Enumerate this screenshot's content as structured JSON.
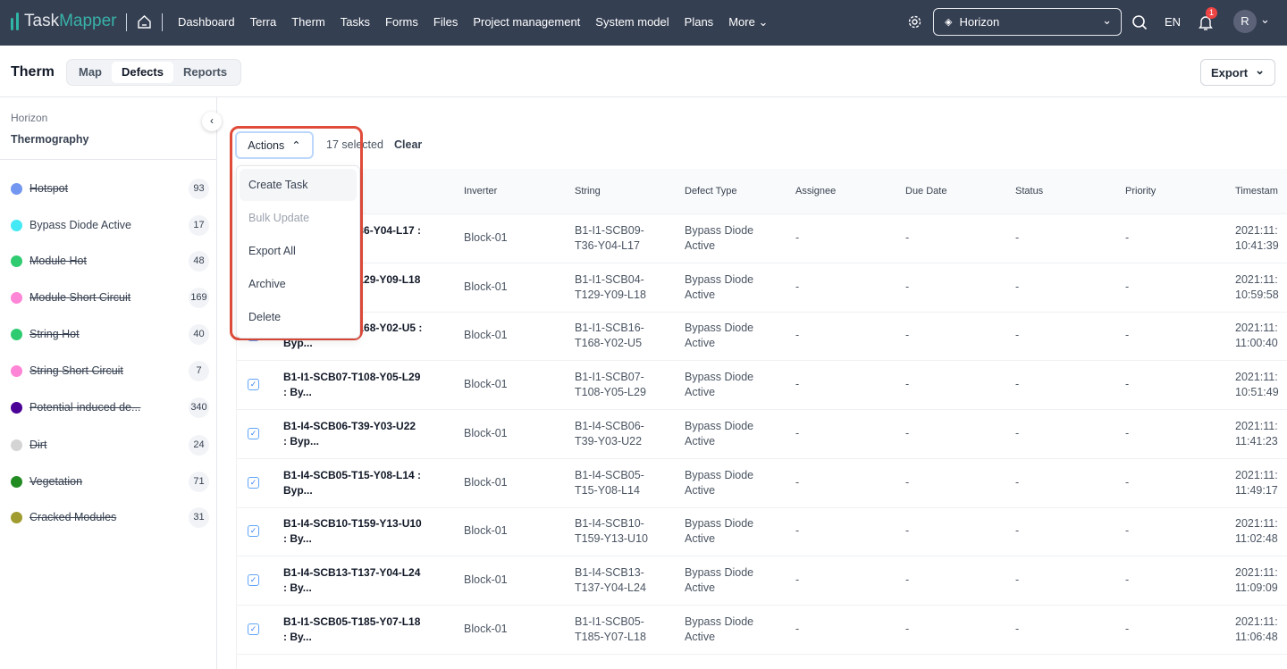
{
  "app": {
    "logo_a": "Task",
    "logo_b": "Mapper",
    "nav": [
      "Dashboard",
      "Terra",
      "Therm",
      "Tasks",
      "Forms",
      "Files",
      "Project management",
      "System model",
      "Plans",
      "More"
    ],
    "project": "Horizon",
    "lang": "EN",
    "notif_count": "1",
    "avatar": "R"
  },
  "page": {
    "title": "Therm",
    "tabs": [
      "Map",
      "Defects",
      "Reports"
    ],
    "active_tab": "Defects",
    "export": "Export"
  },
  "sidebar": {
    "org": "Horizon",
    "section": "Thermography",
    "items": [
      {
        "label": "Hotspot",
        "count": "93",
        "color": "#7396f0",
        "struck": true
      },
      {
        "label": "Bypass Diode Active",
        "count": "17",
        "color": "#45e8f5",
        "struck": false
      },
      {
        "label": "Module Hot",
        "count": "48",
        "color": "#2fcb71",
        "struck": true
      },
      {
        "label": "Module Short Circuit",
        "count": "169",
        "color": "#ff85d6",
        "struck": true
      },
      {
        "label": "String Hot",
        "count": "40",
        "color": "#2fcb71",
        "struck": true
      },
      {
        "label": "String Short Circuit",
        "count": "7",
        "color": "#ff85d6",
        "struck": true
      },
      {
        "label": "Potential-induced de...",
        "count": "340",
        "color": "#4b0096",
        "struck": true
      },
      {
        "label": "Dirt",
        "count": "24",
        "color": "#d4d4d4",
        "struck": true
      },
      {
        "label": "Vegetation",
        "count": "71",
        "color": "#228b22",
        "struck": true
      },
      {
        "label": "Cracked Modules",
        "count": "31",
        "color": "#a09c30",
        "struck": true
      }
    ]
  },
  "toolbar": {
    "actions": "Actions",
    "selected": "17 selected",
    "clear": "Clear"
  },
  "menu": [
    "Create Task",
    "Bulk Update",
    "Export All",
    "Archive",
    "Delete"
  ],
  "table": {
    "headers": [
      "Inverter",
      "String",
      "Defect Type",
      "Assignee",
      "Due Date",
      "Status",
      "Priority",
      "Timestam"
    ],
    "rows": [
      {
        "n1": "B1-I1-SCB09-T36-Y04-L17 :",
        "n2": "Byp...",
        "inv": "Block-01",
        "s1": "B1-I1-SCB09-",
        "s2": "T36-Y04-L17",
        "t1": "Bypass Diode",
        "t2": "Active",
        "as": "-",
        "due": "-",
        "st": "-",
        "pr": "-",
        "ts1": "2021:11:",
        "ts2": "10:41:39"
      },
      {
        "n1": "B1-I1-SCB04-T129-Y09-L18",
        "n2": ": Byp...",
        "inv": "Block-01",
        "s1": "B1-I1-SCB04-",
        "s2": "T129-Y09-L18",
        "t1": "Bypass Diode",
        "t2": "Active",
        "as": "-",
        "due": "-",
        "st": "-",
        "pr": "-",
        "ts1": "2021:11:",
        "ts2": "10:59:58"
      },
      {
        "n1": "B1-I1-SCB16-T168-Y02-U5 :",
        "n2": "Byp...",
        "inv": "Block-01",
        "s1": "B1-I1-SCB16-",
        "s2": "T168-Y02-U5",
        "t1": "Bypass Diode",
        "t2": "Active",
        "as": "-",
        "due": "-",
        "st": "-",
        "pr": "-",
        "ts1": "2021:11:",
        "ts2": "11:00:40"
      },
      {
        "n1": "B1-I1-SCB07-T108-Y05-L29",
        "n2": ": By...",
        "inv": "Block-01",
        "s1": "B1-I1-SCB07-",
        "s2": "T108-Y05-L29",
        "t1": "Bypass Diode",
        "t2": "Active",
        "as": "-",
        "due": "-",
        "st": "-",
        "pr": "-",
        "ts1": "2021:11:",
        "ts2": "10:51:49"
      },
      {
        "n1": "B1-I4-SCB06-T39-Y03-U22",
        "n2": ": Byp...",
        "inv": "Block-01",
        "s1": "B1-I4-SCB06-",
        "s2": "T39-Y03-U22",
        "t1": "Bypass Diode",
        "t2": "Active",
        "as": "-",
        "due": "-",
        "st": "-",
        "pr": "-",
        "ts1": "2021:11:",
        "ts2": "11:41:23"
      },
      {
        "n1": "B1-I4-SCB05-T15-Y08-L14 :",
        "n2": "Byp...",
        "inv": "Block-01",
        "s1": "B1-I4-SCB05-",
        "s2": "T15-Y08-L14",
        "t1": "Bypass Diode",
        "t2": "Active",
        "as": "-",
        "due": "-",
        "st": "-",
        "pr": "-",
        "ts1": "2021:11:",
        "ts2": "11:49:17"
      },
      {
        "n1": "B1-I4-SCB10-T159-Y13-U10",
        "n2": ": By...",
        "inv": "Block-01",
        "s1": "B1-I4-SCB10-",
        "s2": "T159-Y13-U10",
        "t1": "Bypass Diode",
        "t2": "Active",
        "as": "-",
        "due": "-",
        "st": "-",
        "pr": "-",
        "ts1": "2021:11:",
        "ts2": "11:02:48"
      },
      {
        "n1": "B1-I4-SCB13-T137-Y04-L24",
        "n2": ": By...",
        "inv": "Block-01",
        "s1": "B1-I4-SCB13-",
        "s2": "T137-Y04-L24",
        "t1": "Bypass Diode",
        "t2": "Active",
        "as": "-",
        "due": "-",
        "st": "-",
        "pr": "-",
        "ts1": "2021:11:",
        "ts2": "11:09:09"
      },
      {
        "n1": "B1-I1-SCB05-T185-Y07-L18",
        "n2": ": By...",
        "inv": "Block-01",
        "s1": "B1-I1-SCB05-",
        "s2": "T185-Y07-L18",
        "t1": "Bypass Diode",
        "t2": "Active",
        "as": "-",
        "due": "-",
        "st": "-",
        "pr": "-",
        "ts1": "2021:11:",
        "ts2": "11:06:48"
      }
    ]
  }
}
